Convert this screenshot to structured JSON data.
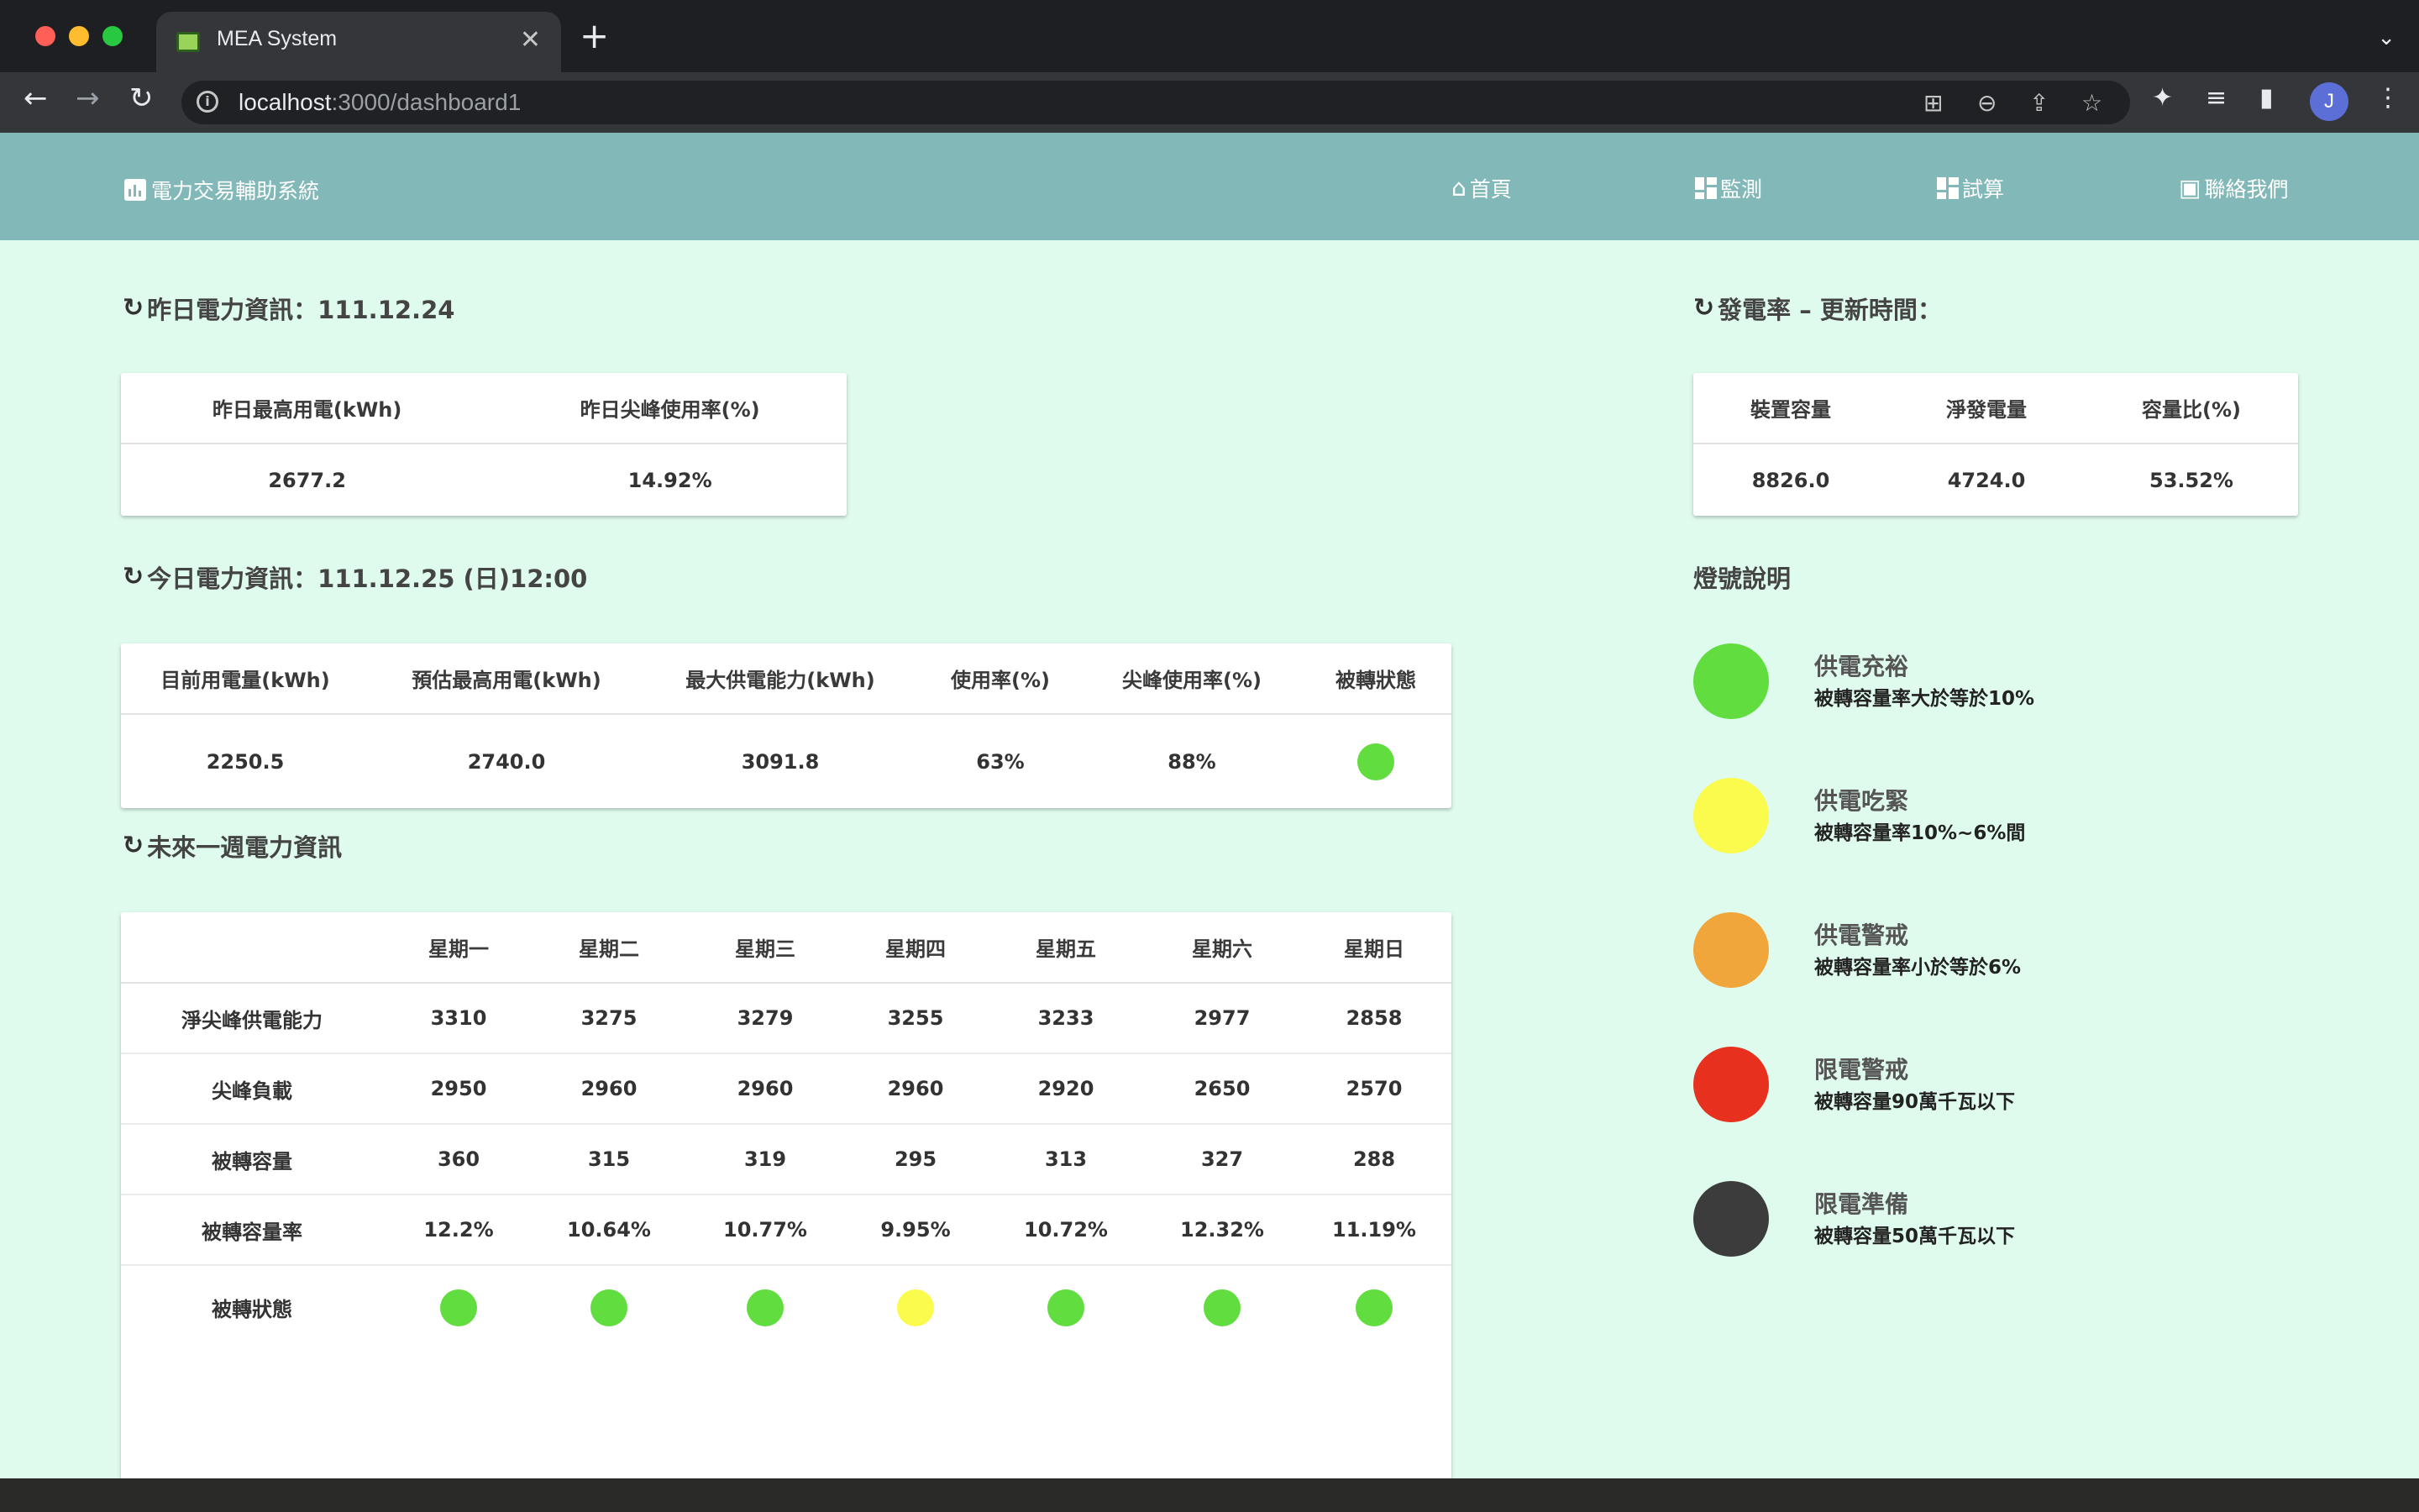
{
  "browser": {
    "tab_title": "MEA System",
    "url_host": "localhost",
    "url_path": ":3000/dashboard1",
    "avatar_letter": "J"
  },
  "app": {
    "brand": "電力交易輔助系統",
    "nav": {
      "home": "首頁",
      "monitor": "監測",
      "calc": "試算",
      "contact": "聯絡我們"
    }
  },
  "yesterday": {
    "title": "昨日電力資訊：111.12.24",
    "headers": [
      "昨日最高用電(kWh)",
      "昨日尖峰使用率(%)"
    ],
    "values": [
      "2677.2",
      "14.92%"
    ]
  },
  "today": {
    "title": "今日電力資訊：111.12.25 (日)12:00",
    "headers": [
      "目前用電量(kWh)",
      "預估最高用電(kWh)",
      "最大供電能力(kWh)",
      "使用率(%)",
      "尖峰使用率(%)",
      "被轉狀態"
    ],
    "values": [
      "2250.5",
      "2740.0",
      "3091.8",
      "63%",
      "88%"
    ],
    "status_color": "#61dd3f"
  },
  "week": {
    "title": "未來一週電力資訊",
    "days": [
      "星期一",
      "星期二",
      "星期三",
      "星期四",
      "星期五",
      "星期六",
      "星期日"
    ],
    "rows": [
      {
        "label": "淨尖峰供電能力",
        "values": [
          "3310",
          "3275",
          "3279",
          "3255",
          "3233",
          "2977",
          "2858"
        ]
      },
      {
        "label": "尖峰負載",
        "values": [
          "2950",
          "2960",
          "2960",
          "2960",
          "2920",
          "2650",
          "2570"
        ]
      },
      {
        "label": "被轉容量",
        "values": [
          "360",
          "315",
          "319",
          "295",
          "313",
          "327",
          "288"
        ]
      },
      {
        "label": "被轉容量率",
        "values": [
          "12.2%",
          "10.64%",
          "10.77%",
          "9.95%",
          "10.72%",
          "12.32%",
          "11.19%"
        ]
      }
    ],
    "status_label": "被轉狀態",
    "status_colors": [
      "#61dd3f",
      "#61dd3f",
      "#61dd3f",
      "#fbfb4e",
      "#61dd3f",
      "#61dd3f",
      "#61dd3f"
    ]
  },
  "generation": {
    "title": "發電率 – 更新時間：",
    "headers": [
      "裝置容量",
      "淨發電量",
      "容量比(%)"
    ],
    "values": [
      "8826.0",
      "4724.0",
      "53.52%"
    ]
  },
  "legend": {
    "title": "燈號說明",
    "items": [
      {
        "title": "供電充裕",
        "desc": "被轉容量率大於等於10%",
        "color": "#61dd3f"
      },
      {
        "title": "供電吃緊",
        "desc": "被轉容量率10%~6%間",
        "color": "#fbfb4e"
      },
      {
        "title": "供電警戒",
        "desc": "被轉容量率小於等於6%",
        "color": "#f0a63a"
      },
      {
        "title": "限電警戒",
        "desc": "被轉容量90萬千瓦以下",
        "color": "#e8301f"
      },
      {
        "title": "限電準備",
        "desc": "被轉容量50萬千瓦以下",
        "color": "#3c3c3c"
      }
    ]
  }
}
